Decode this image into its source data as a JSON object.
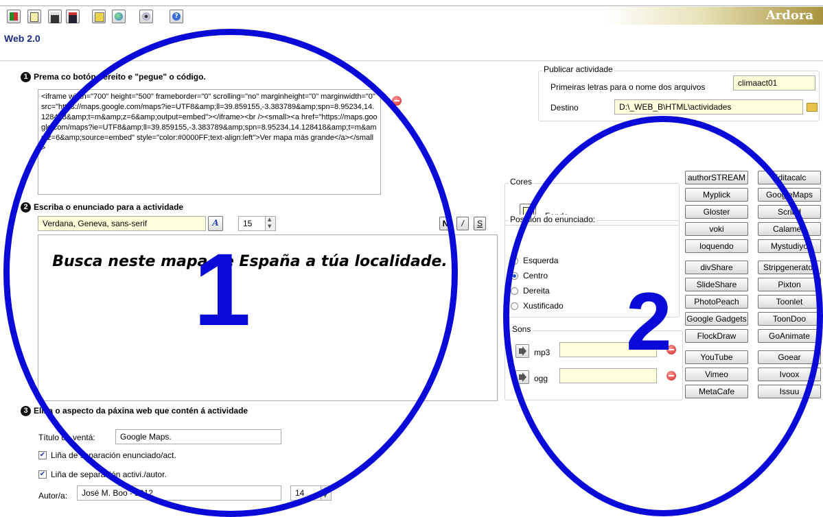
{
  "app": {
    "brand": "Ardora",
    "page_title": "Web 2.0"
  },
  "toolbar": {
    "buttons": [
      "exit-icon",
      "new-document-icon",
      "save-as-icon",
      "save-icon",
      "dictionary-icon",
      "globe-icon",
      "preview-icon",
      "help-icon"
    ]
  },
  "section1": {
    "number": "1",
    "title": "Prema co botón dereito e \"pegue\" o código.",
    "code": "<iframe width=\"700\" height=\"500\" frameborder=\"0\" scrolling=\"no\" marginheight=\"0\" marginwidth=\"0\" src=\"https://maps.google.com/maps?ie=UTF8&amp;ll=39.859155,-3.383789&amp;spn=8.95234,14.128418&amp;t=m&amp;z=6&amp;output=embed\"></iframe><br /><small><a href=\"https://maps.google.com/maps?ie=UTF8&amp;ll=39.859155,-3.383789&amp;spn=8.95234,14.128418&amp;t=m&amp;z=6&amp;source=embed\" style=\"color:#0000FF;text-align:left\">Ver mapa más grande</a></small>"
  },
  "section2": {
    "number": "2",
    "title": "Escriba o enunciado para a actividade",
    "font": "Verdana, Geneva, sans-serif",
    "font_button": "A",
    "size": "15",
    "format_buttons": [
      "N",
      "/",
      "S"
    ],
    "statement": "Busca neste mapa de España a túa localidade."
  },
  "section3": {
    "number": "3",
    "title": "Elixa o aspecto da páxina web que contén á actividade",
    "title_label": "Título da ventá:",
    "title_value": "Google Maps.",
    "check1": "Liña de separación enunciado/act.",
    "check2": "Liña de separación activi./autor.",
    "author_label": "Autor/a:",
    "author_value": "José M. Boo - 2012",
    "author_size": "14"
  },
  "publish": {
    "legend": "Publicar actividade",
    "prefix_label": "Primeiras letras para o nome dos arquivos",
    "prefix_value": "climaact01",
    "dest_label": "Destino",
    "dest_value": "D:\\_WEB_B\\HTML\\actividades"
  },
  "colors": {
    "legend": "Cores",
    "bg_label": "Fondo",
    "swatch": "#ffffc0"
  },
  "position": {
    "legend": "Posición do enunciado:",
    "options": [
      "Esquerda",
      "Centro",
      "Dereita",
      "Xustificado"
    ],
    "selected": "Centro"
  },
  "sounds": {
    "legend": "Sons",
    "mp3": "mp3",
    "ogg": "ogg"
  },
  "services": {
    "left": [
      "authorSTREAM",
      "Myplick",
      "Gloster",
      "voki",
      "loquendo",
      "divShare",
      "SlideShare",
      "PhotoPeach",
      "Google Gadgets",
      "FlockDraw",
      "YouTube",
      "Vimeo",
      "MetaCafe"
    ],
    "right": [
      "Editacalc",
      "GoogleMaps",
      "Scribd",
      "Calameo",
      "Mystudiyo",
      "Stripgenerator",
      "Pixton",
      "Toonlet",
      "ToonDoo",
      "GoAnimate",
      "Goear",
      "Ivoox",
      "Issuu"
    ]
  },
  "annotations": {
    "one": "1",
    "two": "2"
  },
  "accent": "#0a0ad8"
}
